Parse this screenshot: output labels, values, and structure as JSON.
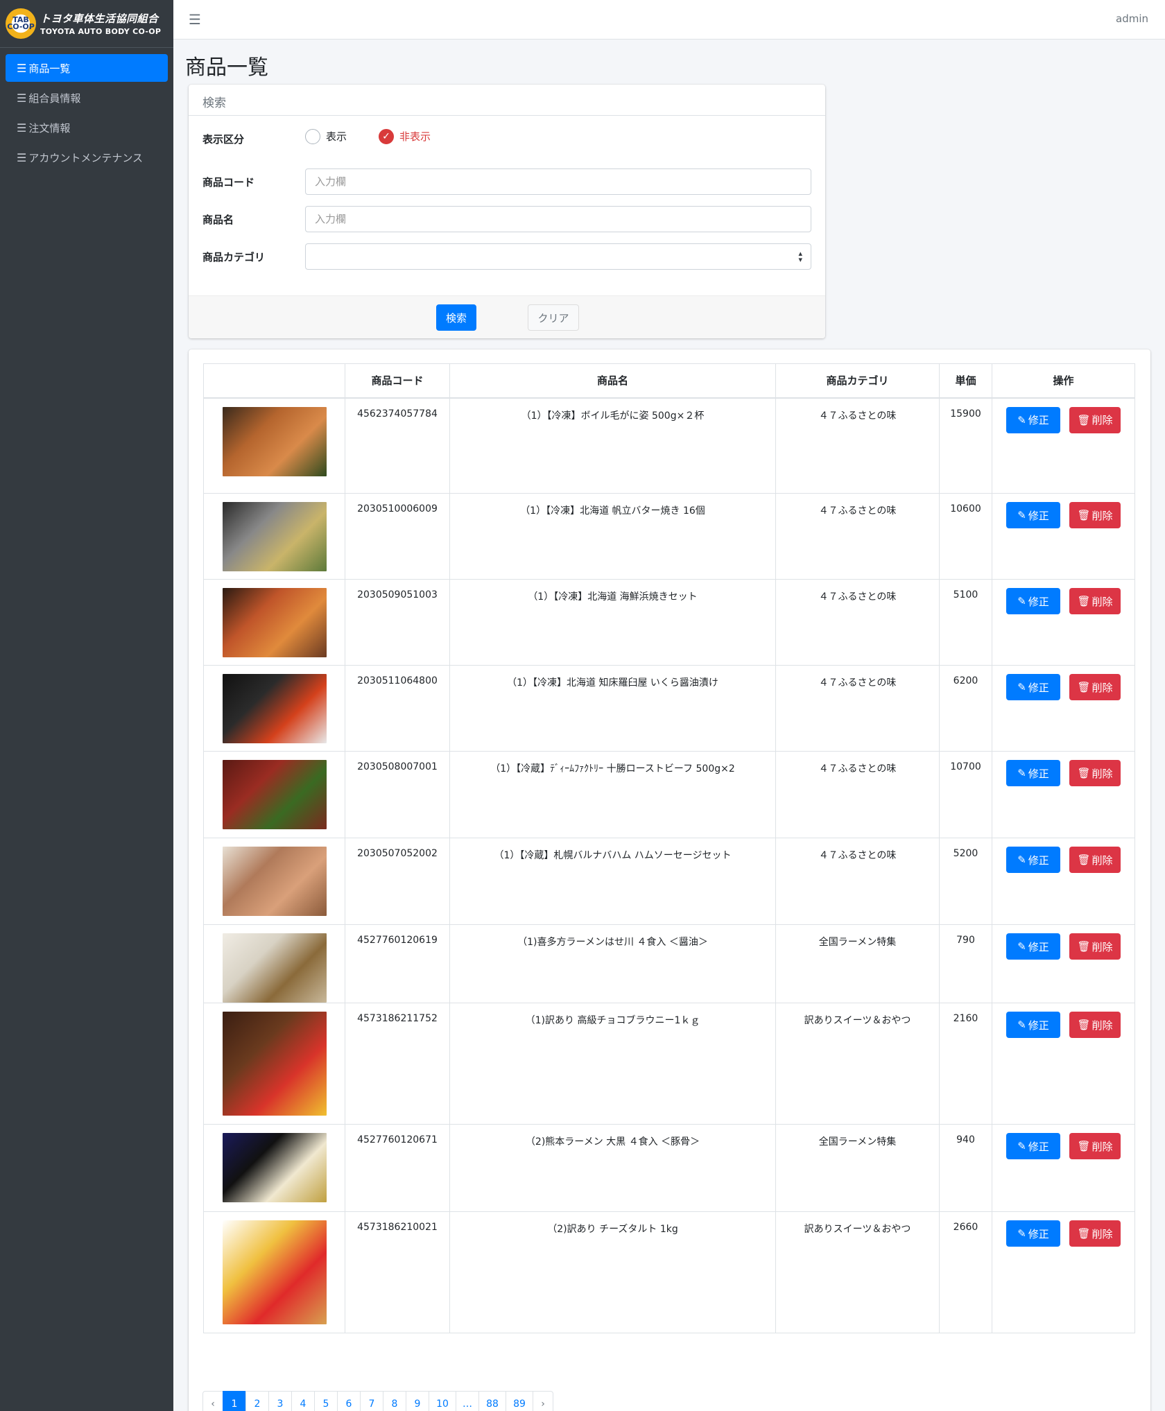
{
  "brand": {
    "badge": "TAB CO-OP",
    "name_jp": "トヨタ車体生活協同組合",
    "name_en": "TOYOTA AUTO BODY CO-OP"
  },
  "sidebar": {
    "items": [
      {
        "label": "商品一覧",
        "active": true
      },
      {
        "label": "組合員情報",
        "active": false
      },
      {
        "label": "注文情報",
        "active": false
      },
      {
        "label": "アカウントメンテナンス",
        "active": false
      }
    ],
    "icon": "list-icon"
  },
  "topbar": {
    "menu_icon": "hamburger-icon",
    "user": "admin"
  },
  "page": {
    "title": "商品一覧"
  },
  "search": {
    "title": "検索",
    "display_label": "表示区分",
    "radio_show": "表示",
    "radio_hide": "非表示",
    "selected": "非表示",
    "code_label": "商品コード",
    "code_placeholder": "入力欄",
    "name_label": "商品名",
    "name_placeholder": "入力欄",
    "category_label": "商品カテゴリ",
    "category_value": "",
    "search_button": "検索",
    "clear_button": "クリア"
  },
  "table": {
    "headers": [
      "",
      "商品コード",
      "商品名",
      "商品カテゴリ",
      "単価",
      "操作"
    ],
    "edit_label": "修正",
    "delete_label": "削除",
    "rows": [
      {
        "code": "4562374057784",
        "name": "（1）【冷凍】ボイル毛がに姿 500g×２杯",
        "category": "４７ふるさとの味",
        "price": "15900",
        "img": [
          "#3a2a1c",
          "#b5652e",
          "#d98a4a",
          "#2f4a1e"
        ]
      },
      {
        "code": "2030510006009",
        "name": "（1）【冷凍】北海道 帆立バター焼き 16個",
        "category": "４７ふるさとの味",
        "price": "10600",
        "img": [
          "#2a2a2a",
          "#888888",
          "#c9b46a",
          "#5d7a3a"
        ]
      },
      {
        "code": "2030509051003",
        "name": "（1）【冷凍】北海道 海鮮浜焼きセット",
        "category": "４７ふるさとの味",
        "price": "5100",
        "img": [
          "#2a1a12",
          "#c0552a",
          "#e08a3c",
          "#6a3a22"
        ]
      },
      {
        "code": "2030511064800",
        "name": "（1）【冷凍】北海道 知床羅臼屋 いくら醤油漬け",
        "category": "４７ふるさとの味",
        "price": "6200",
        "img": [
          "#111111",
          "#2b2b2b",
          "#d4411c",
          "#e8e8e8"
        ]
      },
      {
        "code": "2030508007001",
        "name": "（1）【冷蔵】ﾃﾞｨｰﾑﾌｧｸﾄﾘｰ 十勝ローストビーフ 500g×2",
        "category": "４７ふるさとの味",
        "price": "10700",
        "img": [
          "#5a1a14",
          "#9a2c22",
          "#3a6a22",
          "#7a2a1e"
        ]
      },
      {
        "code": "2030507052002",
        "name": "（1）【冷蔵】札幌バルナバハム ハムソーセージセット",
        "category": "４７ふるさとの味",
        "price": "5200",
        "img": [
          "#e8e0d4",
          "#b07a5a",
          "#d9a07a",
          "#8a5a3a"
        ]
      },
      {
        "code": "4527760120619",
        "name": "（1)喜多方ラーメンはせ川 ４食入 ＜醤油＞",
        "category": "全国ラーメン特集",
        "price": "790",
        "img": [
          "#f0ece4",
          "#d8d2c4",
          "#8a6a3a",
          "#c8b89a"
        ]
      },
      {
        "code": "4573186211752",
        "name": "（1)訳あり 高級チョコブラウニー1ｋｇ",
        "category": "訳ありスイーツ＆おやつ",
        "price": "2160",
        "img": [
          "#3a1e12",
          "#6a3a1e",
          "#d8342a",
          "#f0c030"
        ]
      },
      {
        "code": "4527760120671",
        "name": "（2)熊本ラーメン 大黒 ４食入 ＜豚骨＞",
        "category": "全国ラーメン特集",
        "price": "940",
        "img": [
          "#1a1a5a",
          "#111111",
          "#f0e8d0",
          "#c0a040"
        ]
      },
      {
        "code": "4573186210021",
        "name": "（2)訳あり チーズタルト 1kg",
        "category": "訳ありスイーツ＆おやつ",
        "price": "2660",
        "img": [
          "#ffffff",
          "#f0c040",
          "#e02a2a",
          "#d8a050"
        ]
      }
    ]
  },
  "pagination": {
    "prev": "‹",
    "next": "›",
    "pages": [
      "1",
      "2",
      "3",
      "4",
      "5",
      "6",
      "7",
      "8",
      "9",
      "10",
      "…",
      "88",
      "89"
    ],
    "current": "1"
  }
}
